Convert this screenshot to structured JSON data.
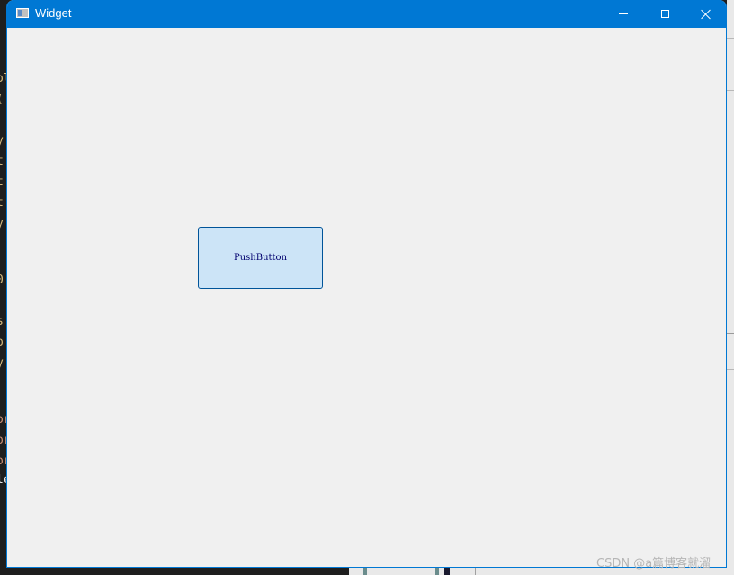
{
  "window": {
    "title": "Widget",
    "accent_color": "#0078d4",
    "client_bg": "#f0f0f0",
    "controls": {
      "minimize_icon": "minimize-icon",
      "maximize_icon": "maximize-icon",
      "close_icon": "close-icon"
    }
  },
  "widget": {
    "push_button_label": "PushButton",
    "push_button_bg": "#cce4f7",
    "push_button_border": "#005499"
  },
  "background": {
    "code_glyphs": [
      "ol",
      "(",
      "y",
      "t",
      "t",
      "t",
      "y",
      "0",
      "s",
      "o",
      "y",
      "or",
      "or",
      "or",
      "le"
    ]
  },
  "watermark": {
    "text": "CSDN @a篇博客就溜"
  }
}
